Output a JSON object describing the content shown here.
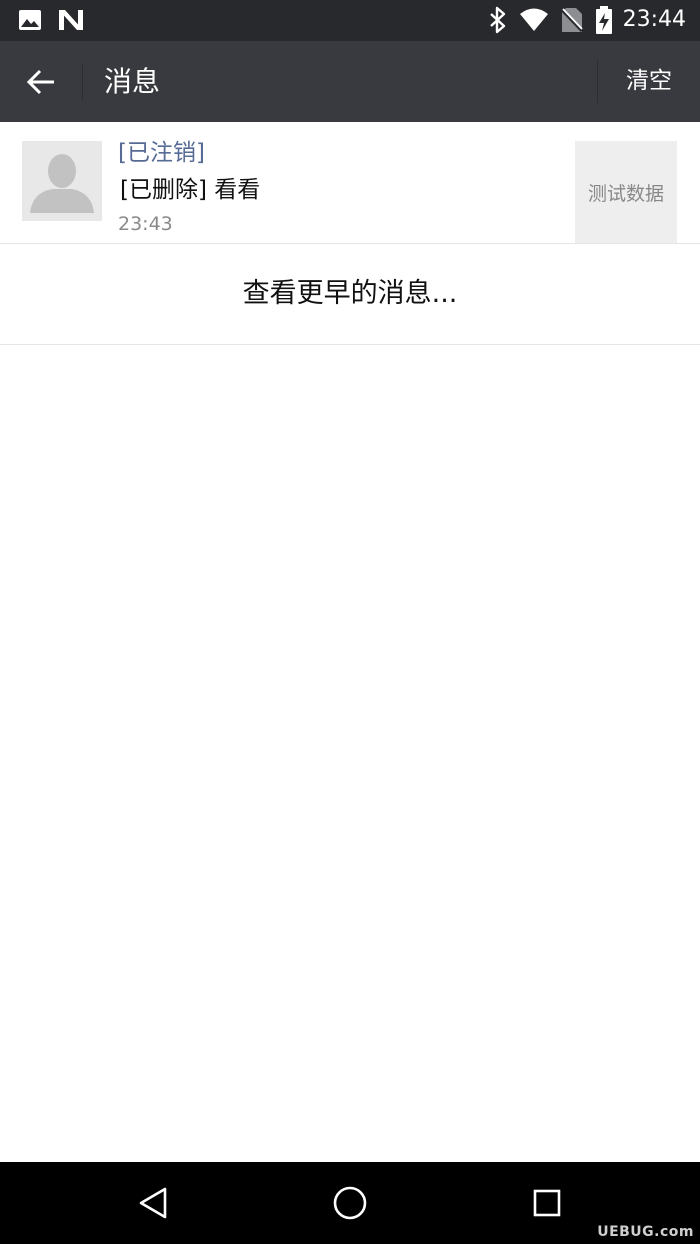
{
  "status_bar": {
    "time": "23:44",
    "icons": [
      "gallery-icon",
      "n-logo-icon",
      "bluetooth-icon",
      "wifi-icon",
      "no-sim-icon",
      "battery-charging-icon"
    ]
  },
  "header": {
    "title": "消息",
    "clear_label": "清空",
    "back_icon": "arrow-left-icon"
  },
  "messages": [
    {
      "sender": "[已注销]",
      "text": "[已删除] 看看",
      "time": "23:43",
      "thumb_text": "测试数据",
      "avatar_icon": "default-avatar-icon"
    }
  ],
  "load_more_label": "查看更早的消息...",
  "nav_bar": {
    "icons": [
      "back-triangle-icon",
      "home-circle-icon",
      "recents-square-icon"
    ]
  },
  "watermark": "UEBUG.com",
  "colors": {
    "status_bar": "#28292d",
    "title_bar": "#393a3f",
    "sender_name": "#576b95",
    "nav_bar": "#000000"
  }
}
